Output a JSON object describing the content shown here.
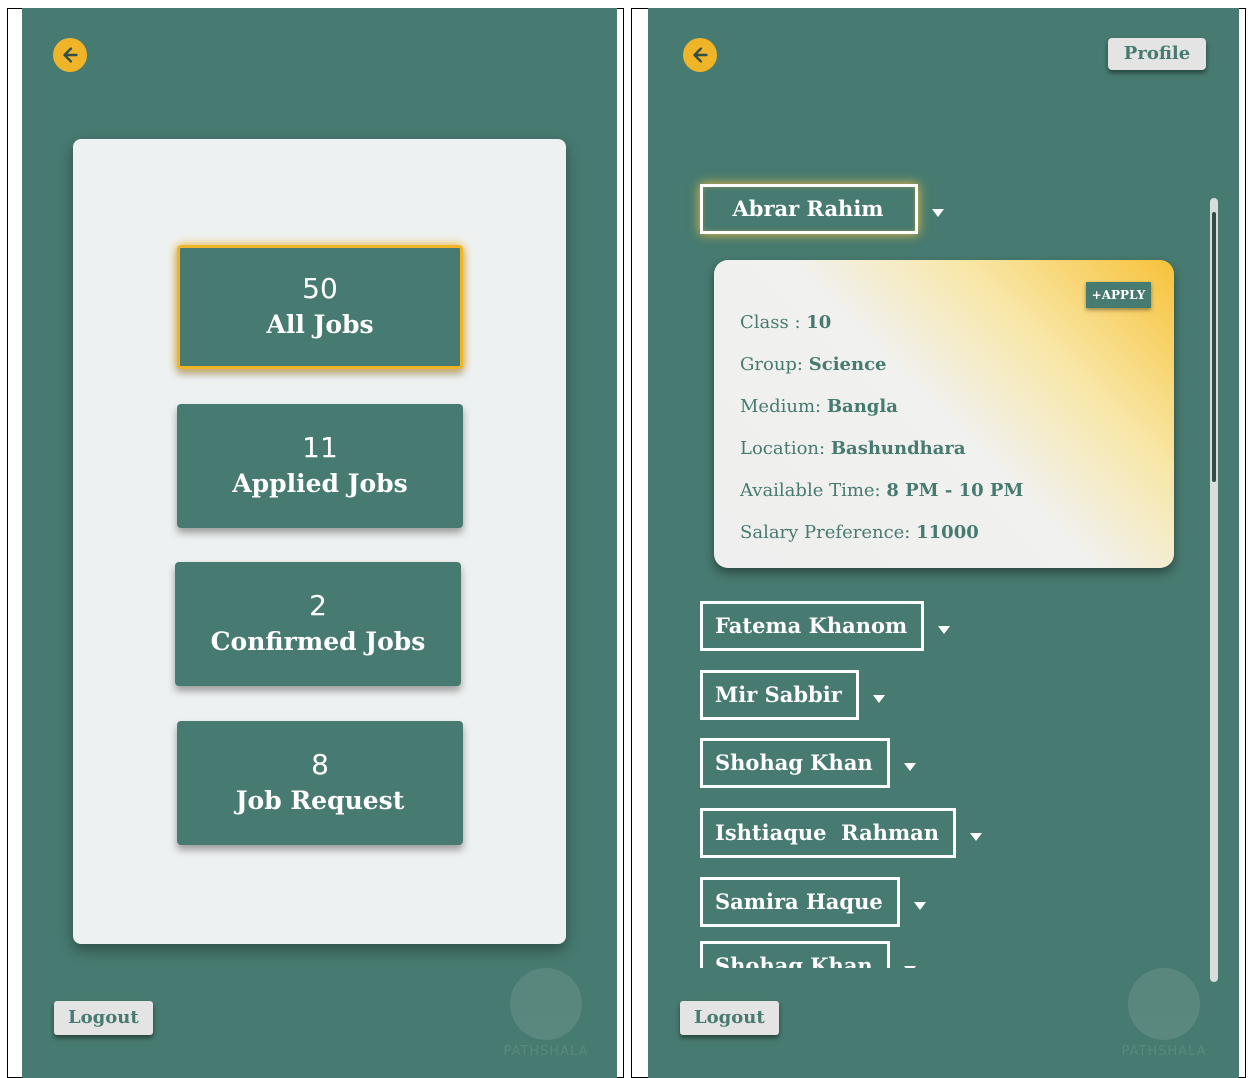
{
  "left_screen": {
    "stats": [
      {
        "count": "50",
        "label": "All Jobs"
      },
      {
        "count": "11",
        "label": "Applied Jobs"
      },
      {
        "count": "2",
        "label": "Confirmed Jobs"
      },
      {
        "count": "8",
        "label": "Job Request"
      }
    ],
    "logout_label": "Logout"
  },
  "right_screen": {
    "profile_label": "Profile",
    "logout_label": "Logout",
    "selected_student": {
      "name": "Abrar Rahim",
      "apply_label": "+APPLY",
      "details": [
        {
          "label": "Class :",
          "value": "10"
        },
        {
          "label": "Group:",
          "value": "Science"
        },
        {
          "label": "Medium:",
          "value": "Bangla"
        },
        {
          "label": "Location:",
          "value": "Bashundhara"
        },
        {
          "label": "Available Time:",
          "value": "8 PM - 10 PM"
        },
        {
          "label": "Salary Preference:",
          "value": "11000"
        }
      ]
    },
    "students": [
      "Fatema Khanom",
      "Mir Sabbir",
      "Shohag Khan",
      "Ishtiaque  Rahman",
      "Samira Haque",
      "Shohag Khan"
    ]
  },
  "colors": {
    "background": "#477a70",
    "accent": "#f0b429",
    "card": "#eef1f1"
  },
  "icons": {
    "back": "arrow-left-circle-icon",
    "dropdown": "caret-down-icon",
    "watermark": "app-logo-icon"
  }
}
